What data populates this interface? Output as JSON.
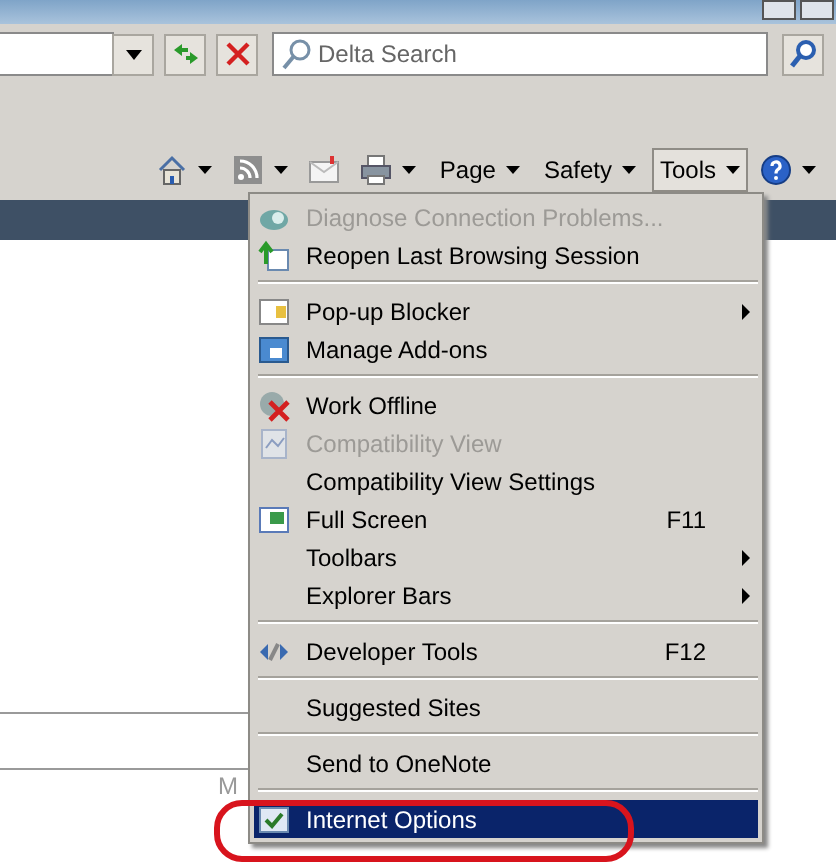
{
  "address_bar": {
    "search": {
      "placeholder": "Delta Search"
    }
  },
  "command_bar": [
    {
      "kind": "icon",
      "arrow": true
    },
    {
      "kind": "icon",
      "arrow": true
    },
    {
      "kind": "icon",
      "arrow": false
    },
    {
      "kind": "icon",
      "arrow": true
    },
    {
      "kind": "text",
      "label": "Page",
      "arrow": true,
      "selected": false
    },
    {
      "kind": "text",
      "label": "Safety",
      "arrow": true,
      "selected": false
    },
    {
      "kind": "text",
      "label": "Tools",
      "arrow": true,
      "selected": true
    },
    {
      "kind": "icon",
      "arrow": true
    }
  ],
  "page_fragment": "M",
  "tools_menu": [
    {
      "kind": "item",
      "label": "Diagnose Connection Problems...",
      "disabled": true,
      "selected": false
    },
    {
      "kind": "item",
      "label": "Reopen Last Browsing Session",
      "disabled": false,
      "selected": false
    },
    {
      "kind": "separator"
    },
    {
      "kind": "item",
      "label": "Pop-up Blocker",
      "disabled": false,
      "submenu": true,
      "selected": false
    },
    {
      "kind": "item",
      "label": "Manage Add-ons",
      "disabled": false,
      "selected": false
    },
    {
      "kind": "separator"
    },
    {
      "kind": "item",
      "label": "Work Offline",
      "disabled": false,
      "selected": false
    },
    {
      "kind": "item",
      "label": "Compatibility View",
      "disabled": true,
      "selected": false
    },
    {
      "kind": "item",
      "label": "Compatibility View Settings",
      "disabled": false,
      "selected": false
    },
    {
      "kind": "item",
      "label": "Full Screen",
      "disabled": false,
      "shortcut": "F11",
      "selected": false
    },
    {
      "kind": "item",
      "label": "Toolbars",
      "disabled": false,
      "submenu": true,
      "selected": false
    },
    {
      "kind": "item",
      "label": "Explorer Bars",
      "disabled": false,
      "submenu": true,
      "selected": false
    },
    {
      "kind": "separator"
    },
    {
      "kind": "item",
      "label": "Developer Tools",
      "disabled": false,
      "shortcut": "F12",
      "selected": false
    },
    {
      "kind": "separator"
    },
    {
      "kind": "item",
      "label": "Suggested Sites",
      "disabled": false,
      "selected": false
    },
    {
      "kind": "separator"
    },
    {
      "kind": "item",
      "label": "Send to OneNote",
      "disabled": false,
      "selected": false
    },
    {
      "kind": "separator"
    },
    {
      "kind": "item",
      "label": "Internet Options",
      "disabled": false,
      "selected": true,
      "circled": true
    }
  ]
}
